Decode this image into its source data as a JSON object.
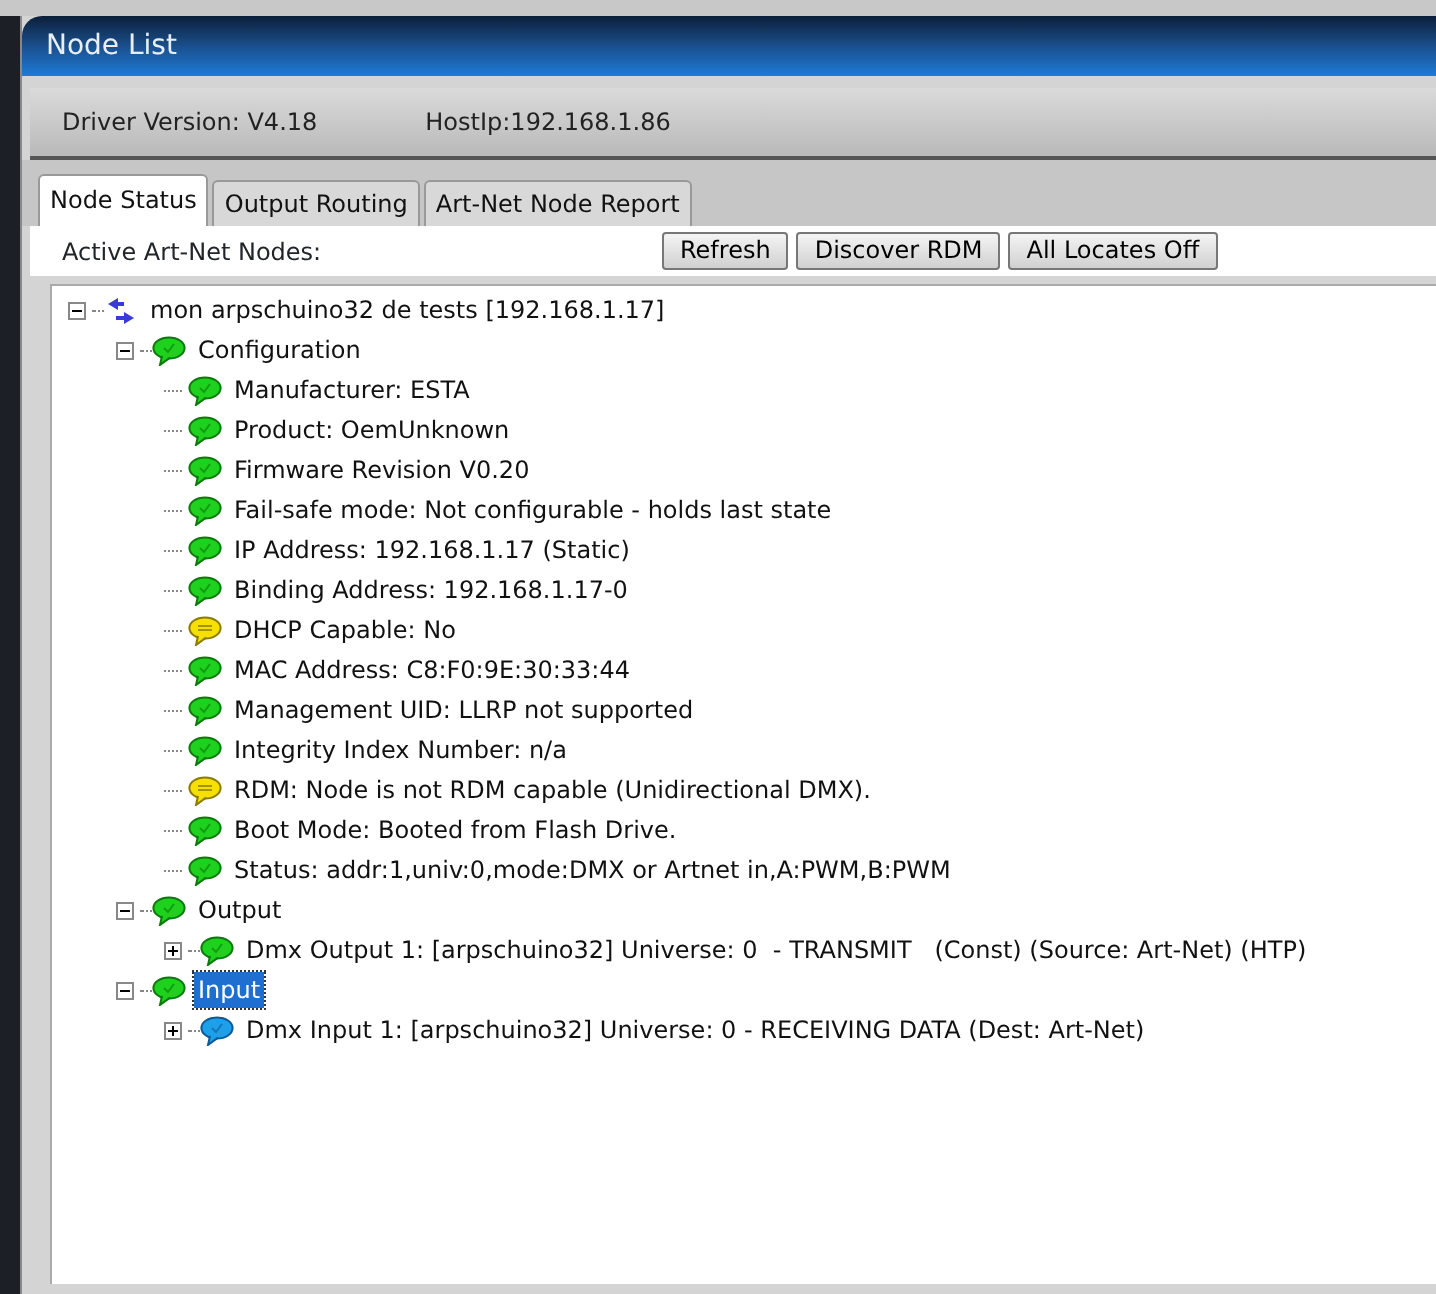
{
  "window": {
    "title": "Node List"
  },
  "info": {
    "driver_version": "Driver Version: V4.18",
    "host_ip": "HostIp:192.168.1.86"
  },
  "tabs": [
    {
      "label": "Node Status",
      "selected": true
    },
    {
      "label": "Output Routing",
      "selected": false
    },
    {
      "label": "Art-Net Node Report",
      "selected": false
    }
  ],
  "toolbar": {
    "label": "Active Art-Net Nodes:",
    "buttons": [
      "Refresh",
      "Discover RDM",
      "All Locates Off"
    ]
  },
  "tree": [
    {
      "label": "mon arpschuino32 de tests [192.168.1.17]",
      "kind": "node",
      "expanded": true,
      "selected": false,
      "children": [
        {
          "label": "Configuration",
          "kind": "ok",
          "expanded": true,
          "selected": false,
          "children": [
            {
              "label": "Manufacturer: ESTA",
              "kind": "ok",
              "selected": false
            },
            {
              "label": "Product: OemUnknown",
              "kind": "ok",
              "selected": false
            },
            {
              "label": "Firmware Revision V0.20",
              "kind": "ok",
              "selected": false
            },
            {
              "label": "Fail-safe mode: Not configurable - holds last state",
              "kind": "ok",
              "selected": false
            },
            {
              "label": "IP Address: 192.168.1.17 (Static)",
              "kind": "ok",
              "selected": false
            },
            {
              "label": "Binding Address: 192.168.1.17-0",
              "kind": "ok",
              "selected": false
            },
            {
              "label": "DHCP Capable: No",
              "kind": "warning",
              "selected": false
            },
            {
              "label": "MAC Address: C8:F0:9E:30:33:44",
              "kind": "ok",
              "selected": false
            },
            {
              "label": "Management UID: LLRP not supported",
              "kind": "ok",
              "selected": false
            },
            {
              "label": "Integrity Index Number: n/a",
              "kind": "ok",
              "selected": false
            },
            {
              "label": "RDM: Node is not RDM capable (Unidirectional DMX).",
              "kind": "warning",
              "selected": false
            },
            {
              "label": "Boot Mode: Booted from Flash Drive.",
              "kind": "ok",
              "selected": false
            },
            {
              "label": "Status: addr:1,univ:0,mode:DMX or Artnet in,A:PWM,B:PWM",
              "kind": "ok",
              "selected": false
            }
          ]
        },
        {
          "label": "Output",
          "kind": "ok",
          "expanded": true,
          "selected": false,
          "children": [
            {
              "label": "Dmx Output 1: [arpschuino32] Universe: 0  - TRANSMIT   (Const) (Source: Art-Net) (HTP)",
              "kind": "ok",
              "expanded": false,
              "selected": false
            }
          ]
        },
        {
          "label": "Input",
          "kind": "ok",
          "expanded": true,
          "selected": true,
          "children": [
            {
              "label": "Dmx Input 1: [arpschuino32] Universe: 0 - RECEIVING DATA (Dest: Art-Net)",
              "kind": "info",
              "expanded": false,
              "selected": false
            }
          ]
        }
      ]
    }
  ]
}
